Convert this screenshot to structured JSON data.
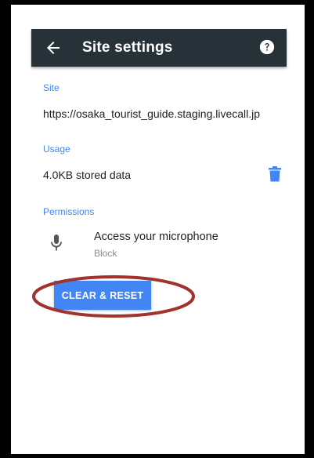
{
  "toolbar": {
    "title": "Site settings",
    "back_icon": "arrow-left-icon",
    "help_icon": "help-circle-icon"
  },
  "site": {
    "label": "Site",
    "url": "https://osaka_tourist_guide.staging.livecall.jp"
  },
  "usage": {
    "label": "Usage",
    "stored": "4.0KB stored data",
    "delete_icon": "trash-icon"
  },
  "permissions": {
    "label": "Permissions",
    "items": [
      {
        "title": "Access your microphone",
        "status": "Block",
        "icon": "microphone-icon"
      }
    ]
  },
  "actions": {
    "clear_reset_label": "CLEAR & RESET"
  },
  "colors": {
    "toolbar_bg": "#263238",
    "accent": "#4285f4",
    "annotation": "#a0332e"
  }
}
